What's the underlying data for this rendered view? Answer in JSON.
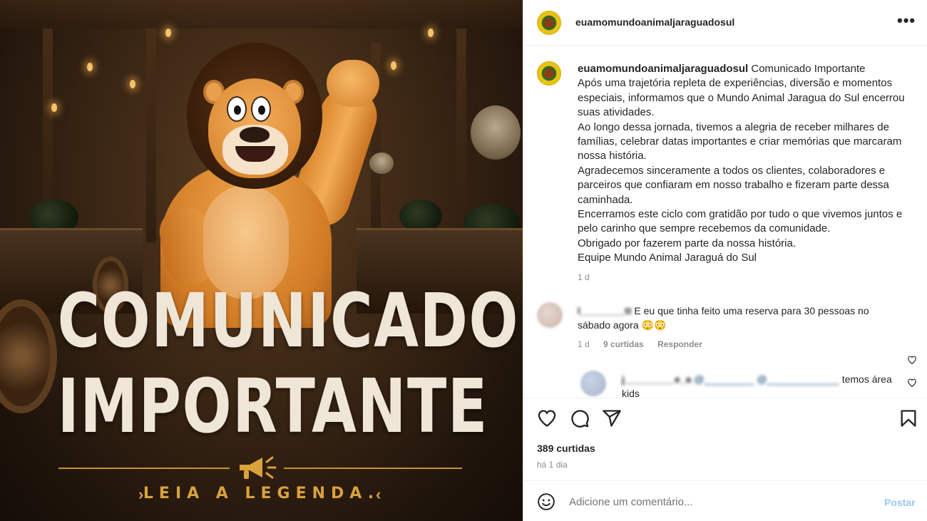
{
  "image": {
    "headline_1": "COMUNICADO",
    "headline_2": "IMPORTANTE",
    "subline": "LEIA A LEGENDA.",
    "chevron_left": "›",
    "chevron_right": "‹"
  },
  "header": {
    "username": "euamomundoanimaljaraguadosul",
    "more_icon": "•••"
  },
  "caption": {
    "username": "euamomundoanimaljaraguadosul",
    "text": " Comunicado Importante\nApós uma trajetória repleta de experiências, diversão e momentos especiais, informamos que o Mundo Animal Jaragua do Sul encerrou suas atividades.\nAo longo dessa jornada, tivemos a alegria de receber milhares de famílias, celebrar datas importantes e criar memórias que marcaram nossa história.\nAgradecemos sinceramente a todos os clientes, colaboradores e parceiros que confiaram em nosso trabalho e fizeram parte dessa caminhada.\nEncerramos este ciclo com gratidão por tudo o que vivemos juntos e pelo carinho que sempre recebemos da comunidade.\nObrigado por fazerem parte da nossa história.\nEquipe Mundo Animal Jaraguá do Sul",
    "time": "1 d"
  },
  "comments": [
    {
      "username": "l________tt",
      "text": " E eu que tinha feito uma reserva para 30 pessoas no sábado agora 😳😳",
      "time": "1 d",
      "likes": "9 curtidas",
      "reply": "Responder"
    }
  ],
  "reply": {
    "username": "j_________e_a",
    "mentions": " @_________ @_____________",
    "text": " temos área kids"
  },
  "actions": {
    "likes": "389 curtidas",
    "date": "há 1 dia"
  },
  "add_comment": {
    "placeholder": "Adicione um comentário...",
    "post_label": "Postar"
  },
  "colors": {
    "link": "#0095f6",
    "post_disabled": "#9ac7f7",
    "headline": "#efe6d8",
    "gold": "#d9a23a"
  }
}
